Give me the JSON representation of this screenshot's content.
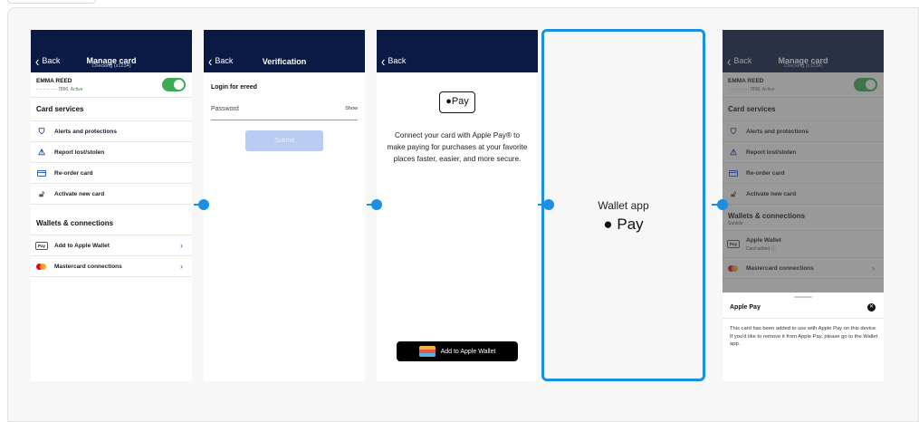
{
  "colors": {
    "nav": "#0b1a45",
    "accent": "#1a8fe3",
    "toggle": "#3cab52",
    "submit_disabled": "#b9cdf3"
  },
  "screen1": {
    "back": "Back",
    "title": "Manage card",
    "subtitle": "Checking (x1234)",
    "account_name": "EMMA REED",
    "account_number": "···· ···· ···· 7890,",
    "account_status": "Active",
    "card_services_heading": "Card services",
    "card_services": [
      {
        "icon": "shield-icon",
        "label": "Alerts and protections"
      },
      {
        "icon": "warning-icon",
        "label": "Report lost/stolen"
      },
      {
        "icon": "card-icon",
        "label": "Re-order card"
      },
      {
        "icon": "lock-icon",
        "label": "Activate new card"
      }
    ],
    "wallets_heading": "Wallets & connections",
    "wallets": [
      {
        "icon": "apple-pay-badge-icon",
        "label": "Add to Apple Wallet"
      },
      {
        "icon": "mastercard-icon",
        "label": "Mastercard connections"
      }
    ]
  },
  "screen2": {
    "back": "Back",
    "title": "Verification",
    "login_heading": "Login for ereed",
    "password_label": "Password",
    "show_label": "Show",
    "submit_label": "Submit"
  },
  "screen3": {
    "back": "Back",
    "apple_pay_logo": "Pay",
    "description": "Connect your card with Apple Pay® to make paying for purchases at your favorite places faster, easier, and more secure.",
    "add_button": "Add to Apple Wallet"
  },
  "screen4": {
    "title": "Wallet app",
    "pay_logo": "Pay"
  },
  "screen5": {
    "back": "Back",
    "title": "Manage card",
    "subtitle": "Checking (x1234)",
    "account_name": "EMMA REED",
    "account_number": "···· ···· ···· 7890,",
    "account_status": "Active",
    "card_services_heading": "Card services",
    "card_services": [
      {
        "icon": "shield-icon",
        "label": "Alerts and protections"
      },
      {
        "icon": "warning-icon",
        "label": "Report lost/stolen"
      },
      {
        "icon": "card-icon",
        "label": "Re-order card"
      },
      {
        "icon": "lock-icon",
        "label": "Activate new card"
      }
    ],
    "wallets_heading": "Wallets & connections",
    "wallets_subtitle": "Subtitle",
    "wallets": [
      {
        "icon": "apple-pay-badge-icon",
        "label": "Apple Wallet",
        "sublabel": "Card added"
      },
      {
        "icon": "mastercard-icon",
        "label": "Mastercard connections"
      }
    ],
    "sheet_title": "Apple Pay",
    "sheet_body": "This card has been added to use with Apple Pay on this device. If you'd like to remove it from Apple Pay, please go to the Wallet app."
  }
}
